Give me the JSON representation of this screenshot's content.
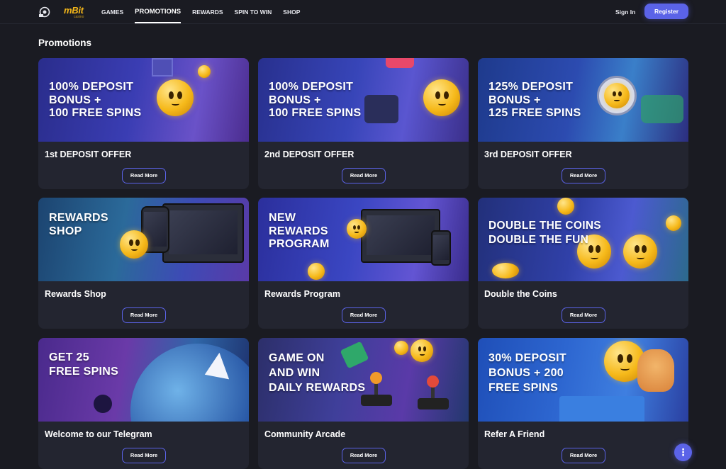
{
  "brand": {
    "name": "mBit",
    "sub": "casino"
  },
  "nav": [
    {
      "label": "GAMES"
    },
    {
      "label": "PROMOTIONS",
      "active": true
    },
    {
      "label": "REWARDS"
    },
    {
      "label": "SPIN TO WIN"
    },
    {
      "label": "SHOP"
    }
  ],
  "auth": {
    "signin": "Sign In",
    "register": "Register"
  },
  "page_title": "Promotions",
  "cards": [
    {
      "banner": "100% DEPOSIT\nBONUS +\n100 FREE SPINS",
      "title": "1st DEPOSIT OFFER",
      "button": "Read More"
    },
    {
      "banner": "100% DEPOSIT\nBONUS +\n100 FREE SPINS",
      "title": "2nd DEPOSIT OFFER",
      "button": "Read More"
    },
    {
      "banner": "125% DEPOSIT\nBONUS +\n125 FREE SPINS",
      "title": "3rd DEPOSIT OFFER",
      "button": "Read More"
    },
    {
      "banner": "REWARDS\nSHOP",
      "title": "Rewards Shop",
      "button": "Read More"
    },
    {
      "banner": "NEW\nREWARDS\nPROGRAM",
      "title": "Rewards Program",
      "button": "Read More"
    },
    {
      "banner": "DOUBLE THE COINS\nDOUBLE THE FUN",
      "title": "Double the Coins",
      "button": "Read More"
    },
    {
      "banner": "GET 25\nFREE SPINS",
      "title": "Welcome to our Telegram",
      "button": "Read More"
    },
    {
      "banner": "GAME ON\nAND WIN\nDAILY REWARDS",
      "title": "Community Arcade",
      "button": "Read More"
    },
    {
      "banner": "30% DEPOSIT\nBONUS + 200\nFREE SPINS",
      "title": "Refer A Friend",
      "button": "Read More"
    }
  ],
  "fab": {
    "label": "⋮",
    "icon": "more-vertical-icon"
  },
  "colors": {
    "background": "#1a1b22",
    "card": "#232530",
    "accent": "#5b63e8",
    "brand": "#f5b719"
  }
}
